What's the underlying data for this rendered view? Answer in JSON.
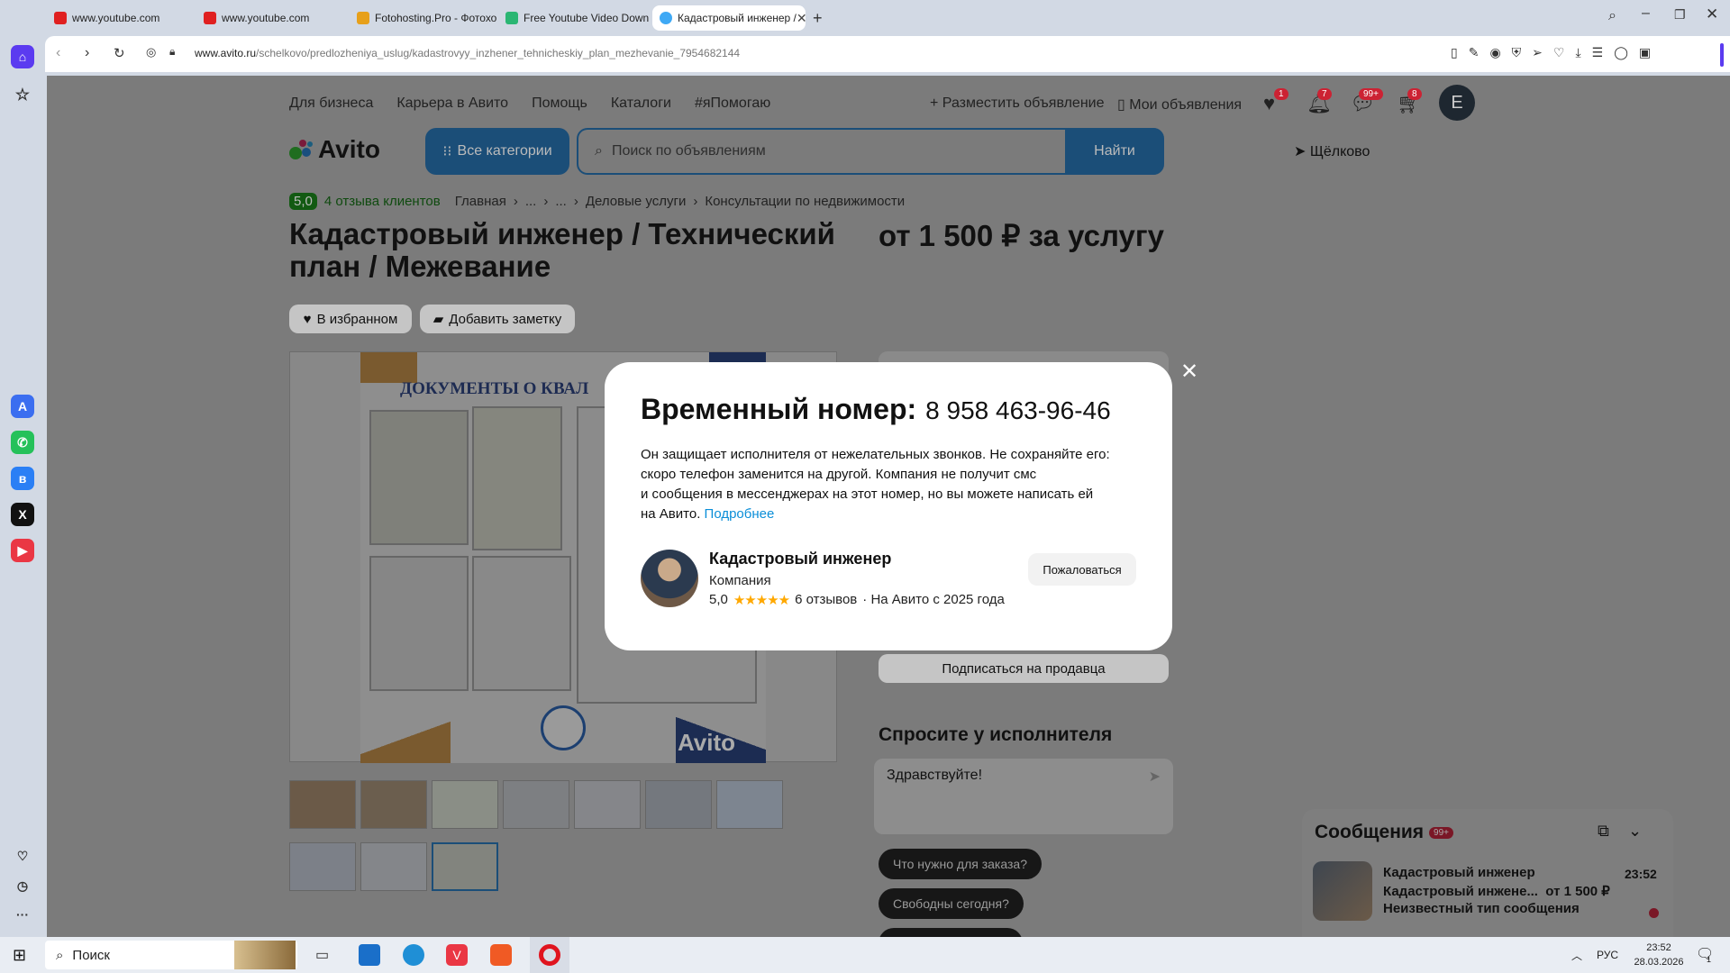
{
  "browser": {
    "tabs": [
      {
        "title": "www.youtube.com",
        "color": "#e02020"
      },
      {
        "title": "www.youtube.com",
        "color": "#e02020"
      },
      {
        "title": "Fotohosting.Pro - Фотохо",
        "color": "#e7a01a"
      },
      {
        "title": "Free Youtube Video Down",
        "color": "#2bb673"
      },
      {
        "title": "Кадастровый инженер /",
        "color": "#3fa9f5"
      }
    ],
    "url_host": "www.avito.ru",
    "url_path": "/schelkovo/predlozheniya_uslug/kadastrovyy_inzhener_tehnicheskiy_plan_mezhevanie_7954682144"
  },
  "topnav": {
    "items": [
      "Для бизнеса",
      "Карьера в Авито",
      "Помощь",
      "Каталоги",
      "#яПомогаю"
    ],
    "post_ad": "Разместить объявление",
    "my_ads": "Мои объявления",
    "badges": {
      "fav": "1",
      "notif": "7",
      "msg": "99+",
      "cart": "8"
    },
    "avatar_letter": "E"
  },
  "header": {
    "logo": "Avito",
    "categories": "Все категории",
    "search_placeholder": "Поиск по объявлениям",
    "search_button": "Найти",
    "location": "Щёлково"
  },
  "breadcrumb": {
    "rating": "5,0",
    "reviews": "4 отзыва клиентов",
    "items": [
      "Главная",
      "...",
      "...",
      "Деловые услуги",
      "Консультации по недвижимости"
    ]
  },
  "listing": {
    "title_line1": "Кадастровый инженер / Технический",
    "title_line2": "план / Межевание",
    "price": "от 1 500 ₽ за услугу",
    "fav_button": "В избранном",
    "note_button": "Добавить заметку",
    "photo_heading": "ДОКУМЕНТЫ О КВАЛ",
    "photo_watermark": "Avito",
    "subscribe": "Подписаться на продавца",
    "ask_heading": "Спросите у исполнителя",
    "ask_text": "Здравствуйте!",
    "quick_replies": [
      "Что нужно для заказа?",
      "Свободны сегодня?"
    ]
  },
  "modal": {
    "title": "Временный номер:",
    "phone": "8 958 463-96-46",
    "text_line1": "Он защищает исполнителя от нежелательных звонков. Не сохраняйте его:",
    "text_line2": "скоро телефон заменится на другой. Компания не получит смс",
    "text_line3": "и сообщения в мессенджерах на этот номер, но вы можете написать ей",
    "text_line4": "на Авито.",
    "more_link": "Подробнее",
    "seller_name": "Кадастровый инженер",
    "seller_type": "Компания",
    "seller_rating": "5,0",
    "seller_reviews": "6 отзывов",
    "seller_since": "· На Авито с 2025 года",
    "complain": "Пожаловаться"
  },
  "messages": {
    "title": "Сообщения",
    "badge": "99+",
    "chat_name": "Кадастровый инженер",
    "chat_time": "23:52",
    "chat_item": "Кадастровый инжене...",
    "chat_price": "от 1 500 ₽",
    "chat_preview": "Неизвестный тип сообщения"
  },
  "taskbar": {
    "search": "Поиск",
    "lang": "РУС",
    "time": "23:52",
    "date": "28.03.2026",
    "notif_count": "1"
  }
}
